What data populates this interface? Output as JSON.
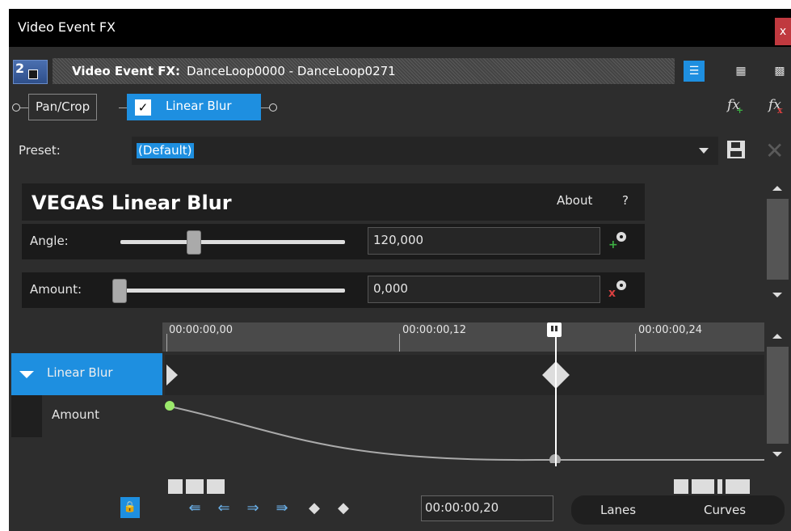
{
  "window": {
    "title": "Video Event FX",
    "close": "x"
  },
  "header": {
    "badge_number": "2",
    "chain_prefix": "Video Event FX:",
    "chain_title": "DanceLoop0000 - DanceLoop0271",
    "view_modes": [
      "list-view-icon",
      "split-view-icon",
      "grid-view-icon"
    ]
  },
  "plugin_chain": {
    "items": [
      {
        "label": "Pan/Crop",
        "checked": null
      },
      {
        "label": "Linear Blur",
        "checked": true
      }
    ],
    "check_mark": "✓",
    "add_fx": "fx",
    "remove_fx": "fx"
  },
  "preset": {
    "label": "Preset:",
    "value": "(Default)"
  },
  "plugin": {
    "name": "VEGAS Linear Blur",
    "about": "About",
    "help": "?",
    "params": [
      {
        "label": "Angle:",
        "value": "120,000",
        "slider_fraction": 0.33
      },
      {
        "label": "Amount:",
        "value": "0,000",
        "slider_fraction": 0.0
      }
    ]
  },
  "timeline": {
    "ruler": [
      "00:00:00,00",
      "00:00:00,12",
      "00:00:00,24"
    ],
    "tracks": [
      {
        "label": "Linear Blur"
      },
      {
        "label": "Amount"
      }
    ]
  },
  "toolbar": {
    "current_time": "00:00:00,20",
    "lanes": "Lanes",
    "curves": "Curves"
  },
  "colors": {
    "accent": "#1e8fe0",
    "close": "#c0393f",
    "background": "#2d2d2d"
  }
}
